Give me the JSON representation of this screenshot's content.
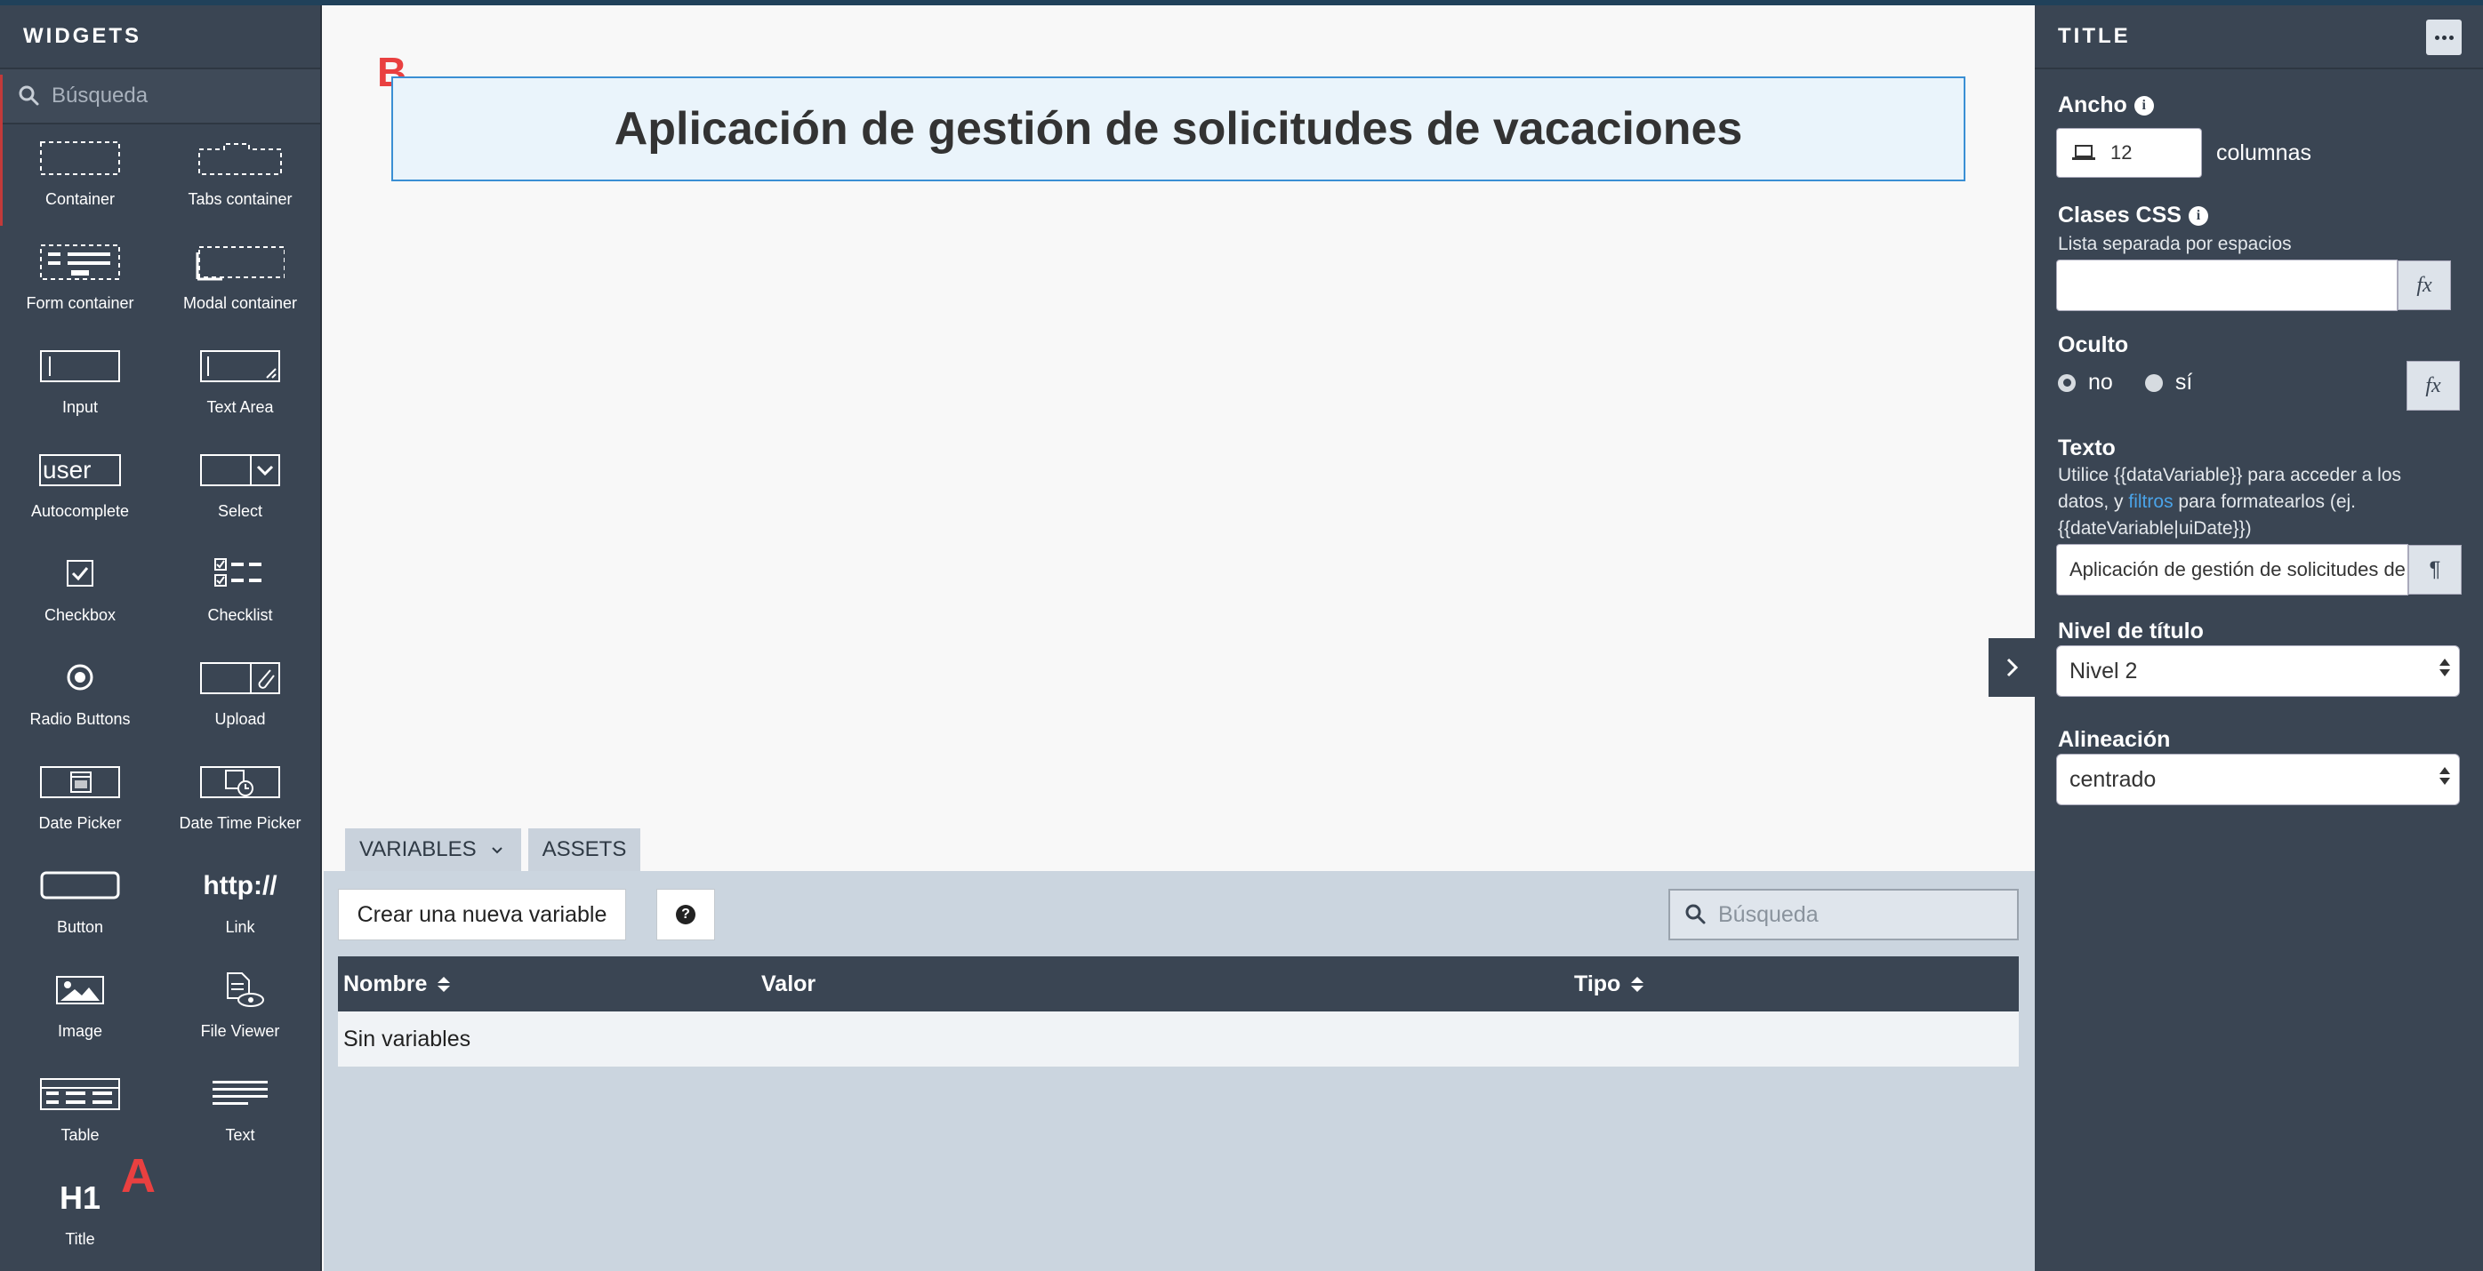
{
  "palette": {
    "title": "WIDGETS",
    "search_placeholder": "Búsqueda",
    "widgets": [
      {
        "label": "Container",
        "icon": "container-icon"
      },
      {
        "label": "Tabs container",
        "icon": "tabs-container-icon"
      },
      {
        "label": "Form container",
        "icon": "form-container-icon"
      },
      {
        "label": "Modal container",
        "icon": "modal-container-icon"
      },
      {
        "label": "Input",
        "icon": "input-icon"
      },
      {
        "label": "Text Area",
        "icon": "text-area-icon"
      },
      {
        "label": "Autocomplete",
        "icon": "autocomplete-icon",
        "icon_text": "user"
      },
      {
        "label": "Select",
        "icon": "select-icon"
      },
      {
        "label": "Checkbox",
        "icon": "checkbox-icon"
      },
      {
        "label": "Checklist",
        "icon": "checklist-icon"
      },
      {
        "label": "Radio Buttons",
        "icon": "radio-buttons-icon"
      },
      {
        "label": "Upload",
        "icon": "upload-icon"
      },
      {
        "label": "Date Picker",
        "icon": "date-picker-icon"
      },
      {
        "label": "Date Time Picker",
        "icon": "date-time-picker-icon"
      },
      {
        "label": "Button",
        "icon": "button-icon"
      },
      {
        "label": "Link",
        "icon": "link-icon",
        "icon_text": "http://"
      },
      {
        "label": "Image",
        "icon": "image-icon"
      },
      {
        "label": "File Viewer",
        "icon": "file-viewer-icon"
      },
      {
        "label": "Table",
        "icon": "table-icon"
      },
      {
        "label": "Text",
        "icon": "text-icon"
      },
      {
        "label": "Title",
        "icon": "title-icon",
        "icon_text": "H1"
      }
    ]
  },
  "annotations": {
    "a": "A",
    "b": "B"
  },
  "canvas": {
    "title_text": "Aplicación de gestión de solicitudes de vacaciones"
  },
  "bottom_panel": {
    "tabs": [
      {
        "label": "VARIABLES"
      },
      {
        "label": "ASSETS"
      }
    ],
    "create_button": "Crear una nueva variable",
    "help_icon": "?",
    "search_placeholder": "Búsqueda",
    "columns": [
      "Nombre",
      "Valor",
      "Tipo"
    ],
    "empty_text": "Sin variables"
  },
  "properties": {
    "title": "TITLE",
    "width_label": "Ancho",
    "width_value": "12",
    "width_unit": "columnas",
    "css_label": "Clases CSS",
    "css_help": "Lista separada por espacios",
    "hidden_label": "Oculto",
    "hidden_options": [
      "no",
      "sí"
    ],
    "hidden_selected": "no",
    "text_label": "Texto",
    "text_help_1": "Utilice {{dataVariable}} para acceder a los datos, y ",
    "text_help_link": "filtros",
    "text_help_2": " para formatearlos (ej. {{dateVariable|uiDate}})",
    "text_value": "Aplicación de gestión de solicitudes de vacaciones",
    "level_label": "Nivel de título",
    "level_value": "Nivel 2",
    "align_label": "Alineación",
    "align_value": "centrado",
    "fx_label": "fx",
    "para_label": "¶"
  }
}
